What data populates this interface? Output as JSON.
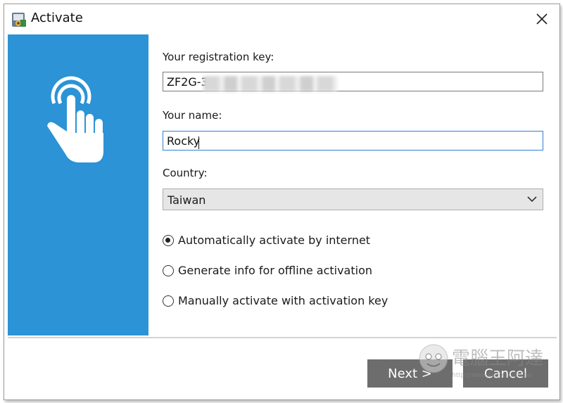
{
  "window": {
    "title": "Activate"
  },
  "icons": {
    "app": "app-icon",
    "close": "close-icon",
    "touch": "touch-icon",
    "dropdown": "chevron-down-icon"
  },
  "form": {
    "key_label": "Your registration key:",
    "key_value": "ZF2G-3",
    "name_label": "Your name:",
    "name_value": "Rocky",
    "country_label": "Country:",
    "country_value": "Taiwan"
  },
  "activation_options": [
    {
      "label": "Automatically activate by internet",
      "selected": true
    },
    {
      "label": "Generate info for offline activation",
      "selected": false
    },
    {
      "label": "Manually activate with activation key",
      "selected": false
    }
  ],
  "buttons": {
    "next": "Next >",
    "cancel": "Cancel"
  },
  "watermark": {
    "text": "電腦王阿達",
    "url": "http://www.kocpc.com.tw"
  },
  "colors": {
    "side_panel": "#2b93d6",
    "focus_border": "#2f7fd8",
    "button_bg": "#6d6d6d"
  }
}
